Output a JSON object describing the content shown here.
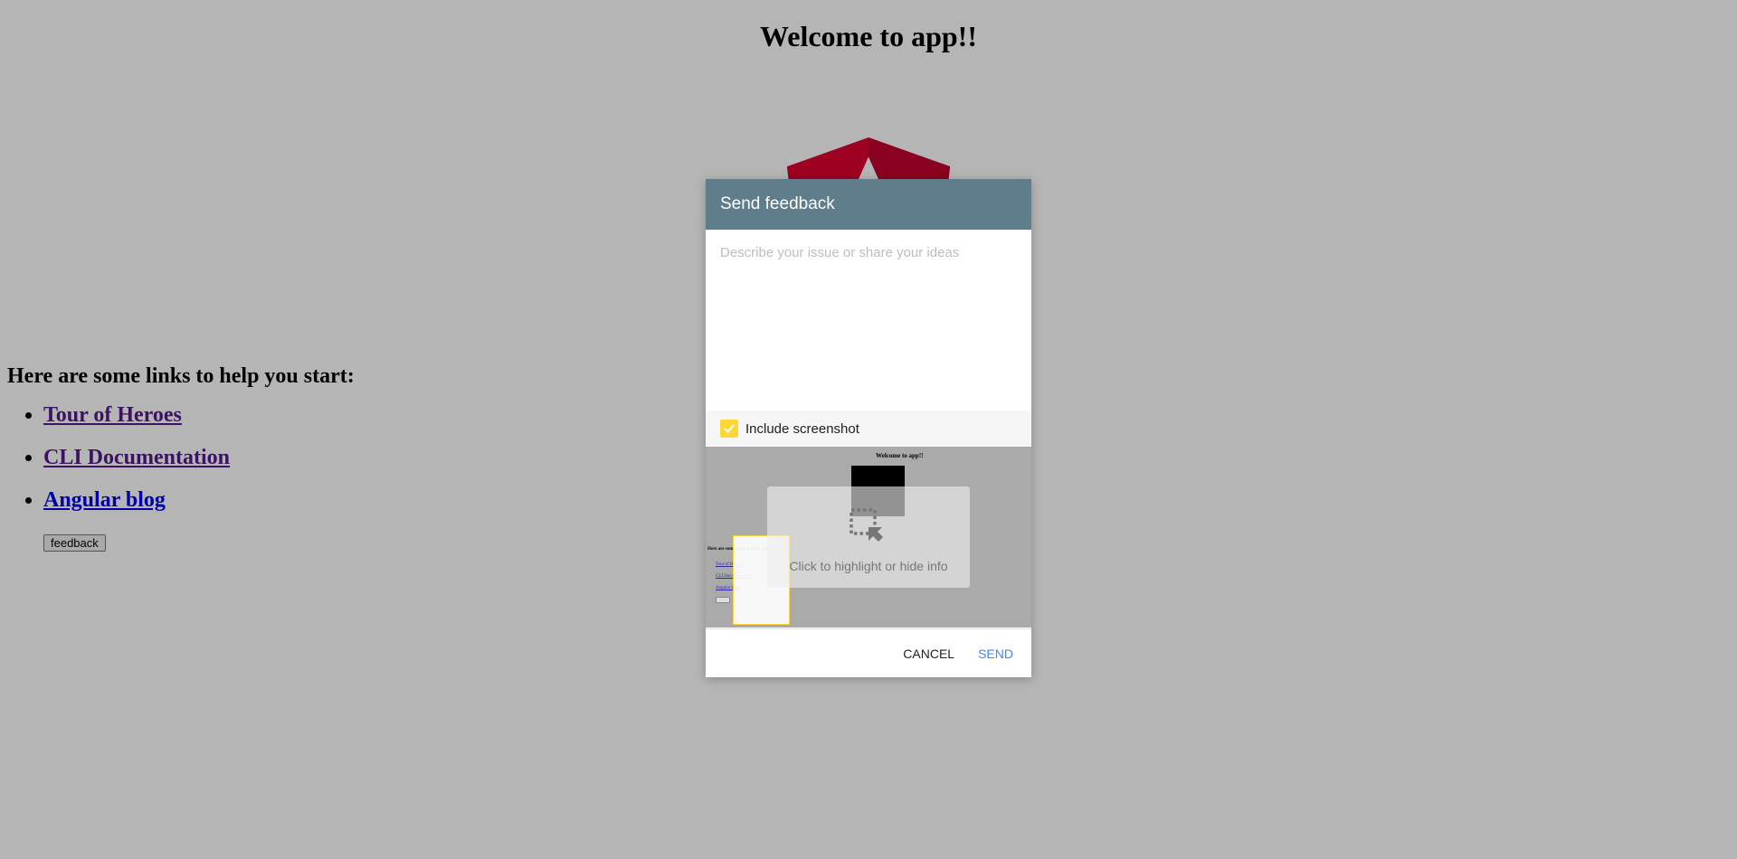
{
  "page": {
    "title": "Welcome to app!!",
    "links_heading": "Here are some links to help you start:",
    "links": [
      {
        "label": "Tour of Heroes"
      },
      {
        "label": "CLI Documentation"
      },
      {
        "label": "Angular blog"
      }
    ],
    "feedback_button": "feedback",
    "logo_icon": "angular-logo-icon"
  },
  "dialog": {
    "title": "Send feedback",
    "description_placeholder": "Describe your issue or share your ideas",
    "description_value": "",
    "include_screenshot_label": "Include screenshot",
    "include_screenshot_checked": true,
    "highlight_hint": "Click to highlight or hide info",
    "cancel_label": "CANCEL",
    "send_label": "SEND"
  },
  "colors": {
    "header": "#607d8b",
    "checkbox": "#fdd835",
    "send": "#4285f4",
    "logo_red": "#dd0031",
    "logo_dark_red": "#c3002f"
  }
}
